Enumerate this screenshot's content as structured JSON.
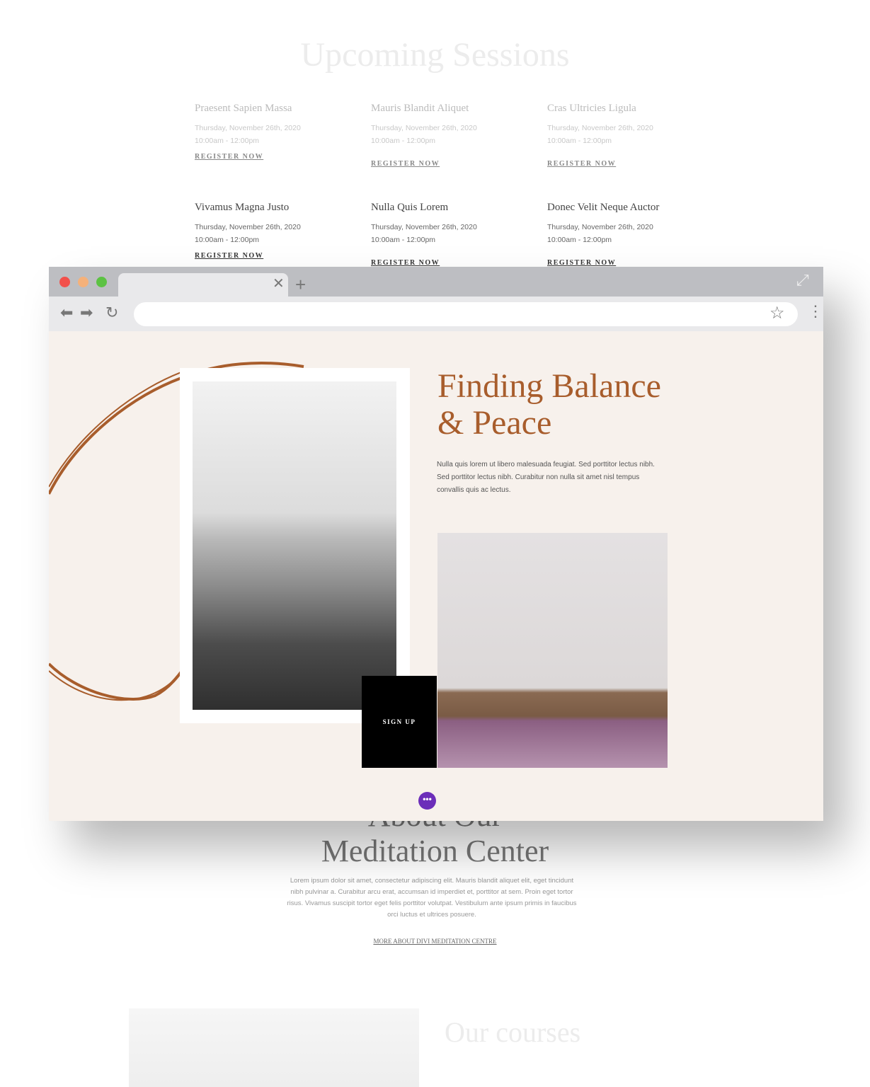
{
  "upcoming": {
    "title": "Upcoming Sessions",
    "sessions": [
      {
        "name": "Praesent Sapien Massa",
        "date": "Thursday, November 26th, 2020",
        "time": "10:00am - 12:00pm",
        "cta": "REGISTER NOW"
      },
      {
        "name": "Mauris Blandit Aliquet",
        "date": "Thursday, November 26th, 2020",
        "time": "10:00am - 12:00pm",
        "cta": "REGISTER NOW"
      },
      {
        "name": "Cras Ultricies Ligula",
        "date": "Thursday, November 26th, 2020",
        "time": "10:00am - 12:00pm",
        "cta": "REGISTER NOW"
      },
      {
        "name": "Vivamus Magna Justo",
        "date": "Thursday, November 26th, 2020",
        "time": "10:00am - 12:00pm",
        "cta": "REGISTER NOW"
      },
      {
        "name": "Nulla Quis Lorem",
        "date": "Thursday, November 26th, 2020",
        "time": "10:00am - 12:00pm",
        "cta": "REGISTER NOW"
      },
      {
        "name": "Donec Velit Neque Auctor",
        "date": "Thursday, November 26th, 2020",
        "time": "10:00am - 12:00pm",
        "cta": "REGISTER NOW"
      }
    ]
  },
  "browser": {
    "icons": [
      "close-dot",
      "minimize-dot",
      "maximize-dot",
      "tab-close-icon",
      "new-tab-icon",
      "expand-icon",
      "back-icon",
      "forward-icon",
      "reload-icon",
      "star-icon",
      "menu-icon"
    ],
    "url": ""
  },
  "hero": {
    "title_line1": "Finding Balance",
    "title_line2": "& Peace",
    "text": "Nulla quis lorem ut libero malesuada feugiat. Sed porttitor lectus nibh. Sed porttitor lectus nibh. Curabitur non nulla sit amet nisl tempus convallis quis ac lectus.",
    "signup": "SIGN UP",
    "more": "•••",
    "accent": "#a85d2c",
    "button_color": "#6c2eb9"
  },
  "about": {
    "title_line1": "About Our",
    "title_line2": "Meditation Center",
    "text": "Lorem ipsum dolor sit amet, consectetur adipiscing elit. Mauris blandit aliquet elit, eget tincidunt nibh pulvinar a. Curabitur arcu erat, accumsan id imperdiet et, porttitor at sem. Proin eget tortor risus. Vivamus suscipit tortor eget felis porttitor volutpat. Vestibulum ante ipsum primis in faucibus orci luctus et ultrices posuere.",
    "link": "MORE ABOUT DIVI MEDITATION CENTRE"
  },
  "courses": {
    "title": "Our courses"
  }
}
